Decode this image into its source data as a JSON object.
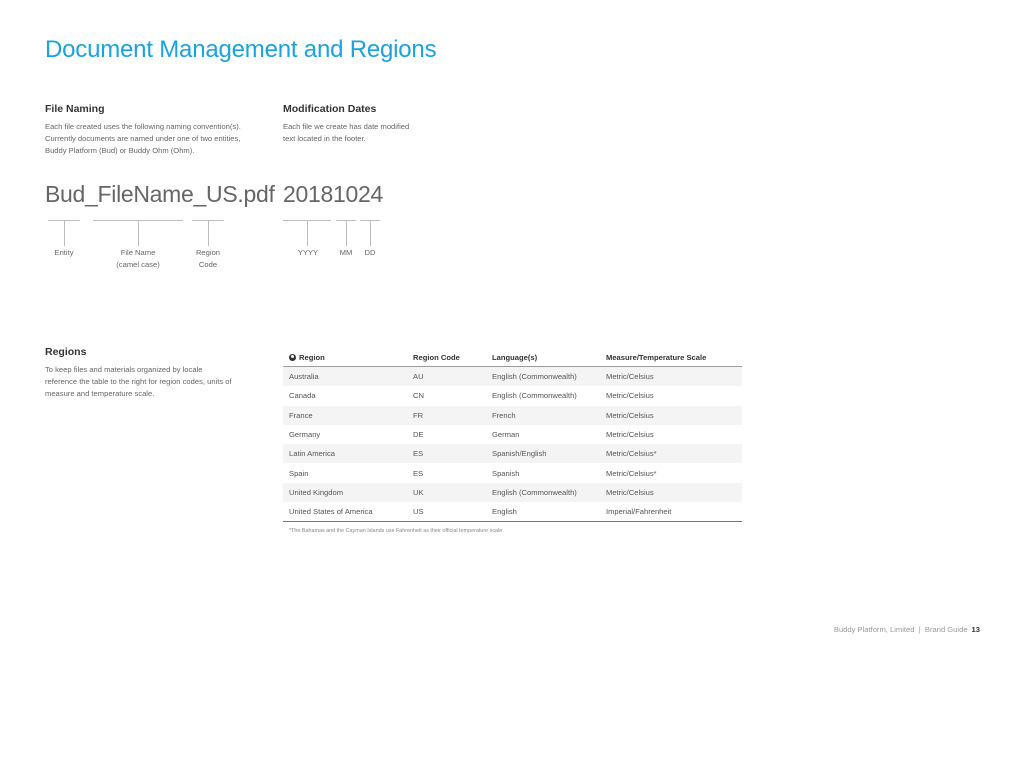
{
  "page": {
    "title": "Document Management and Regions"
  },
  "file_naming": {
    "heading": "File Naming",
    "body": "Each file created uses the following naming convention(s). Currently documents are named under one of two entities, Buddy Platform (Bud) or Buddy Ohm (Ohm).",
    "example": "Bud_FileName_US.pdf",
    "segments": [
      {
        "label": "Entity"
      },
      {
        "label": "File Name\n(camel case)"
      },
      {
        "label": "Region\nCode"
      }
    ]
  },
  "modification_dates": {
    "heading": "Modification Dates",
    "body": "Each file we create has date modified text located in the footer.",
    "example": "20181024",
    "segments": [
      {
        "label": "YYYY"
      },
      {
        "label": "MM"
      },
      {
        "label": "DD"
      }
    ]
  },
  "regions": {
    "heading": "Regions",
    "body": "To keep files and materials organized by locale reference the table to the right for region codes, units of measure and temperature scale.",
    "header_icon": "globe-icon",
    "columns": [
      "Region",
      "Region Code",
      "Language(s)",
      "Measure/Temperature Scale"
    ],
    "rows": [
      [
        "Australia",
        "AU",
        "English (Commonwealth)",
        "Metric/Celsius"
      ],
      [
        "Canada",
        "CN",
        "English (Commonwealth)",
        "Metric/Celsius"
      ],
      [
        "France",
        "FR",
        "French",
        "Metric/Celsius"
      ],
      [
        "Germany",
        "DE",
        "German",
        "Metric/Celsius"
      ],
      [
        "Latin America",
        "ES",
        "Spanish/English",
        "Metric/Celsius*"
      ],
      [
        "Spain",
        "ES",
        "Spanish",
        "Metric/Celsius*"
      ],
      [
        "United Kingdom",
        "UK",
        "English (Commonwealth)",
        "Metric/Celsius"
      ],
      [
        "United States of America",
        "US",
        "English",
        "Imperial/Fahrenheit"
      ]
    ],
    "footnote": "*The Bahamas and the Cayman Islands use Fahrenheit as their official temperature scale"
  },
  "footer": {
    "text": "Buddy Platform, Limited  |  Brand Guide",
    "page_number": "13"
  },
  "colors": {
    "title_blue": "#1aa3de",
    "row_stripe": "#f4f4f4"
  }
}
